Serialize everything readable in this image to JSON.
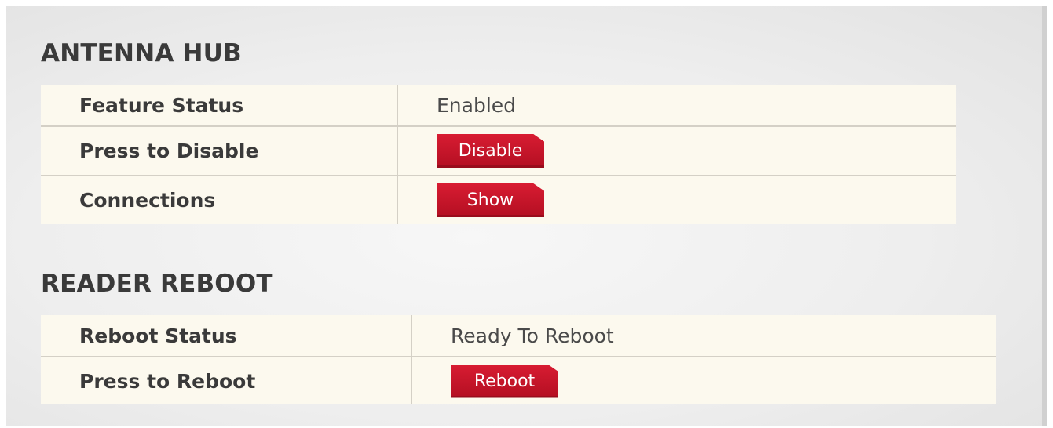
{
  "antenna_hub": {
    "title": "ANTENNA HUB",
    "feature_status_label": "Feature Status",
    "feature_status_value": "Enabled",
    "press_to_disable_label": "Press to Disable",
    "disable_button": "Disable",
    "connections_label": "Connections",
    "show_button": "Show"
  },
  "reader_reboot": {
    "title": "READER REBOOT",
    "reboot_status_label": "Reboot Status",
    "reboot_status_value": "Ready To Reboot",
    "press_to_reboot_label": "Press to Reboot",
    "reboot_button": "Reboot"
  },
  "colors": {
    "button_red": "#c8142a",
    "row_background": "#fcf9ee",
    "heading_text": "#3a3a3a"
  }
}
